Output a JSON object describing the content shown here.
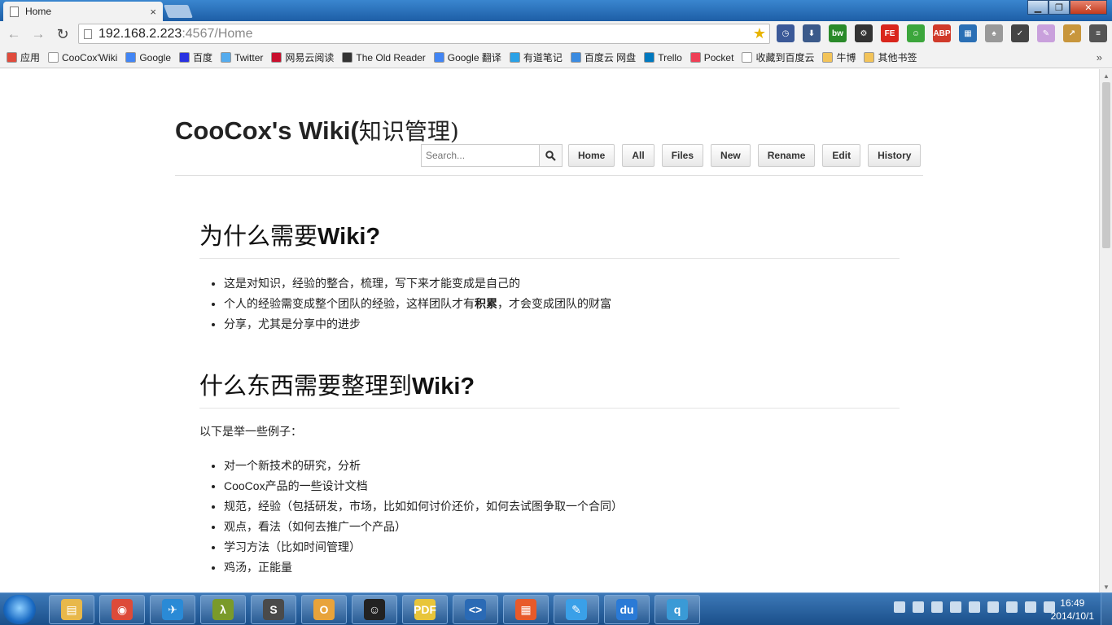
{
  "browser": {
    "tab_title": "Home",
    "tab_close": "×",
    "url_host": "192.168.2.223",
    "url_path": ":4567/Home",
    "window_buttons": {
      "minimize": "▁",
      "maximize": "❐",
      "close": "✕"
    }
  },
  "bookmarks": [
    {
      "label": "应用",
      "color": "#e04b3c"
    },
    {
      "label": "CooCox'Wiki",
      "color": "#ffffff"
    },
    {
      "label": "Google",
      "color": "#4285f4"
    },
    {
      "label": "百度",
      "color": "#2932e1"
    },
    {
      "label": "Twitter",
      "color": "#55acee"
    },
    {
      "label": "网易云阅读",
      "color": "#c8102e"
    },
    {
      "label": "The Old Reader",
      "color": "#333333"
    },
    {
      "label": "Google 翻译",
      "color": "#4285f4"
    },
    {
      "label": "有道笔记",
      "color": "#2aa1e6"
    },
    {
      "label": "百度云 网盘",
      "color": "#3b8be0"
    },
    {
      "label": "Trello",
      "color": "#0079bf"
    },
    {
      "label": "Pocket",
      "color": "#ee4056"
    },
    {
      "label": "收藏到百度云",
      "color": "#ffffff"
    },
    {
      "label": "牛博",
      "color": "#f3c45a"
    },
    {
      "label": "其他书签",
      "color": "#f3c45a"
    }
  ],
  "bookmarks_more": "»",
  "extensions": [
    {
      "name": "clock-extension-icon",
      "label": "◷",
      "color": "#3b5998"
    },
    {
      "name": "download-extension-icon",
      "label": "⬇",
      "color": "#3b5a8a"
    },
    {
      "name": "bw-extension-icon",
      "label": "bw",
      "color": "#2a8a2a"
    },
    {
      "name": "gear-extension-icon",
      "label": "⚙",
      "color": "#333333"
    },
    {
      "name": "fe-extension-icon",
      "label": "FE",
      "color": "#d9261c"
    },
    {
      "name": "frog-extension-icon",
      "label": "☺",
      "color": "#3ca63c"
    },
    {
      "name": "adblock-extension-icon",
      "label": "ABP",
      "color": "#d03a2a"
    },
    {
      "name": "qr-extension-icon",
      "label": "▦",
      "color": "#2a6fb5"
    },
    {
      "name": "evernote-extension-icon",
      "label": "♠",
      "color": "#999999"
    },
    {
      "name": "pocket-extension-icon",
      "label": "✓",
      "color": "#444444"
    },
    {
      "name": "feather-extension-icon",
      "label": "✎",
      "color": "#c9a0dc"
    },
    {
      "name": "tool-extension-icon",
      "label": "↗",
      "color": "#c8963c"
    },
    {
      "name": "menu-icon",
      "label": "≡",
      "color": "#555555"
    }
  ],
  "wiki": {
    "title_en": "CooCox's Wiki(",
    "title_cn": "知识管理)",
    "search_placeholder": "Search...",
    "nav": [
      "Home",
      "All",
      "Files",
      "New",
      "Rename",
      "Edit",
      "History"
    ]
  },
  "content": {
    "section1_title_cn": "为什么需要",
    "section1_title_en": "Wiki?",
    "section1_items": [
      {
        "pre": "这是对知识，经验的整合，梳理，写下来才能变成是自己的",
        "bold": "",
        "post": ""
      },
      {
        "pre": "个人的经验需变成整个团队的经验，这样团队才有",
        "bold": "积累",
        "post": "，才会变成团队的财富"
      },
      {
        "pre": "分享，尤其是分享中的进步",
        "bold": "",
        "post": ""
      }
    ],
    "section2_title_cn": "什么东西需要整理到",
    "section2_title_en": "Wiki?",
    "section2_intro": "以下是举一些例子：",
    "section2_items": [
      "对一个新技术的研究，分析",
      "CooCox产品的一些设计文档",
      "规范，经验（包括研发，市场，比如如何讨价还价，如何去试图争取一个合同）",
      "观点，看法（如何去推广一个产品）",
      "学习方法（比如时间管理）",
      "鸡汤，正能量"
    ]
  },
  "taskbar": {
    "apps": [
      {
        "name": "explorer-icon",
        "label": "▤",
        "color": "#e8b84a"
      },
      {
        "name": "chrome-icon",
        "label": "◉",
        "color": "#dd4b39"
      },
      {
        "name": "bird-app-icon",
        "label": "✈",
        "color": "#2a8ad6"
      },
      {
        "name": "lambda-app-icon",
        "label": "λ",
        "color": "#7a9a2a"
      },
      {
        "name": "sublime-icon",
        "label": "S",
        "color": "#4a4a4a"
      },
      {
        "name": "outlook-icon",
        "label": "O",
        "color": "#e8a33a"
      },
      {
        "name": "smiley-app-icon",
        "label": "☺",
        "color": "#222222"
      },
      {
        "name": "pdf-app-icon",
        "label": "PDF",
        "color": "#e8c53a"
      },
      {
        "name": "code-app-icon",
        "label": "<>",
        "color": "#2a6ab5"
      },
      {
        "name": "grid-app-icon",
        "label": "▦",
        "color": "#e85a2a"
      },
      {
        "name": "note-app-icon",
        "label": "✎",
        "color": "#3aa0e8"
      },
      {
        "name": "baidu-du-icon",
        "label": "du",
        "color": "#2a7ad6"
      },
      {
        "name": "qq-app-icon",
        "label": "q",
        "color": "#3a9ad6"
      }
    ],
    "time": "16:49",
    "date": "2014/10/1"
  }
}
